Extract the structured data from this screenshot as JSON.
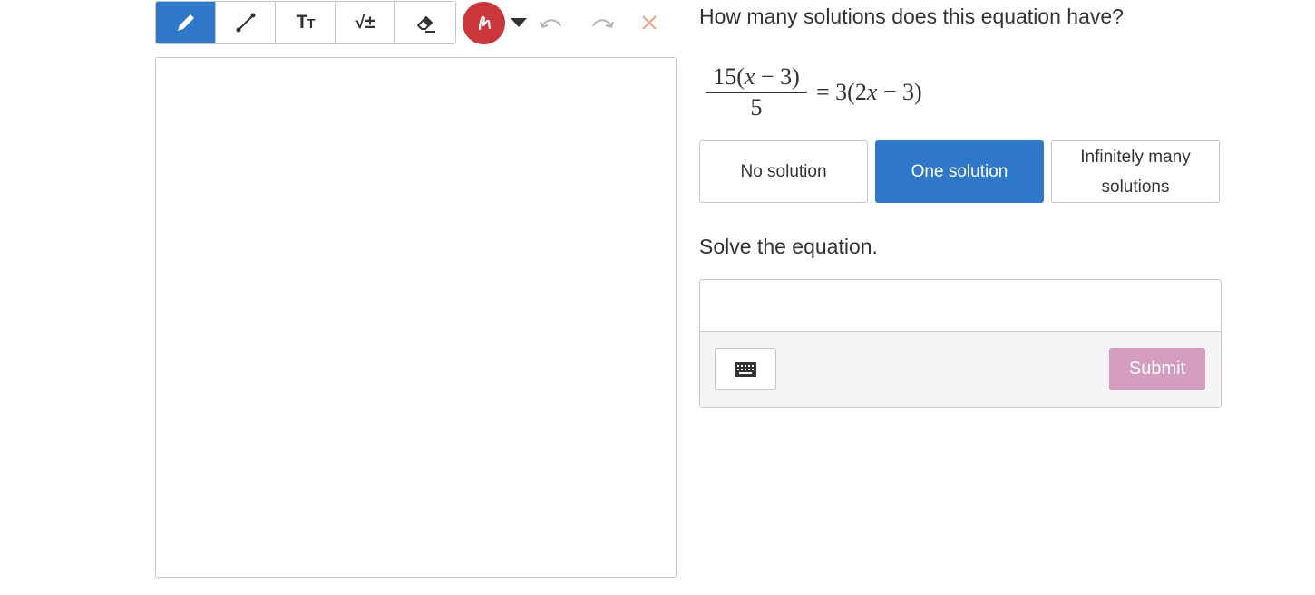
{
  "toolbar": {
    "tools": [
      {
        "name": "pencil-icon",
        "active": true
      },
      {
        "name": "line-icon",
        "active": false
      },
      {
        "name": "text-size-icon",
        "label": "Tт",
        "active": false
      },
      {
        "name": "math-icon",
        "label": "√±",
        "active": false
      },
      {
        "name": "eraser-icon",
        "active": false
      }
    ],
    "pen_color": "#c9373a",
    "accent_color": "#2f78c9"
  },
  "question": {
    "text": "How many solutions does this equation have?",
    "equation": {
      "numerator_prefix": "15(",
      "numerator_var": "x",
      "numerator_suffix": " − 3)",
      "denominator": "5",
      "rhs_prefix": "= 3(2",
      "rhs_var": "x",
      "rhs_suffix": " − 3)"
    },
    "choices": [
      {
        "label": "No solution",
        "selected": false
      },
      {
        "label": "One solution",
        "selected": true
      },
      {
        "label": "Infinitely many solutions",
        "selected": false
      }
    ]
  },
  "solve": {
    "prompt": "Solve the equation.",
    "input_value": "",
    "submit_label": "Submit"
  }
}
